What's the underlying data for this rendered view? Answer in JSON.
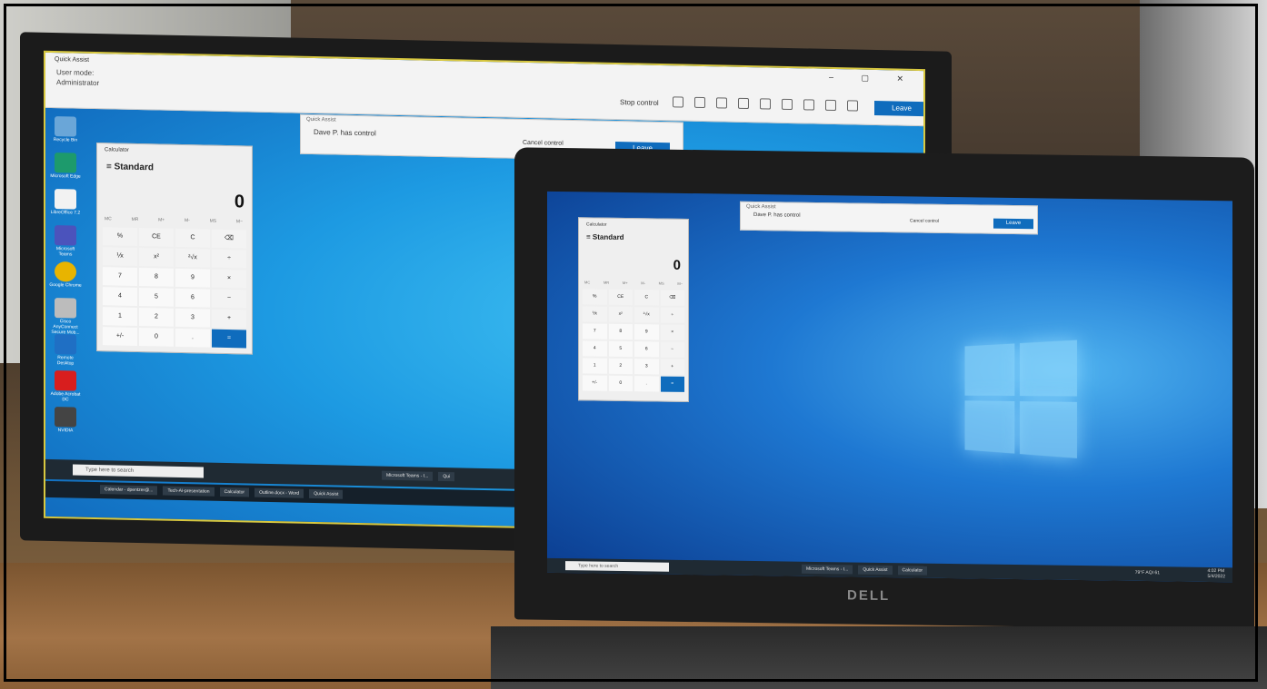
{
  "monitor": {
    "quick_assist_title": "Quick Assist",
    "user_mode_label": "User mode:",
    "user_mode_value": "Administrator",
    "stop_control": "Stop control",
    "leave": "Leave",
    "banner": {
      "title": "Quick Assist",
      "message": "Dave P. has control",
      "cancel": "Cancel control",
      "leave": "Leave"
    },
    "calculator": {
      "title": "Calculator",
      "mode": "Standard",
      "display": "0",
      "memory": [
        "MC",
        "MR",
        "M+",
        "M-",
        "MS",
        "M~"
      ],
      "keys": [
        "%",
        "CE",
        "C",
        "⌫",
        "⅟x",
        "x²",
        "²√x",
        "÷",
        "7",
        "8",
        "9",
        "×",
        "4",
        "5",
        "6",
        "−",
        "1",
        "2",
        "3",
        "+",
        "+/-",
        "0",
        ".",
        "="
      ]
    },
    "search_placeholder": "Type here to search",
    "taskbar_items": [
      "Microsoft Teams - I...",
      "Qui"
    ],
    "taskbar2_items": [
      "Calendar - dpentzer@...",
      "Tech-AI-presentation",
      "Calculator",
      "Outline.docx - Word",
      "Quick Assist"
    ],
    "desktop_icons": [
      {
        "label": "Recycle Bin",
        "color": "#6aa6d8"
      },
      {
        "label": "Microsoft Edge",
        "color": "#1d9a6c"
      },
      {
        "label": "LibreOffice 7.2",
        "color": "#f2f2f2"
      },
      {
        "label": "Microsoft Teams",
        "color": "#4b53bc"
      },
      {
        "label": "Google Chrome",
        "color": "#e8b400"
      },
      {
        "label": "Cisco AnyConnect Secure Mob...",
        "color": "#bcbcbc"
      },
      {
        "label": "Remote Desktop",
        "color": "#1f6fc4"
      },
      {
        "label": "Adobe Acrobat DC",
        "color": "#d81e1e"
      },
      {
        "label": "NVIDIA",
        "color": "#444444"
      }
    ]
  },
  "laptop": {
    "banner": {
      "title": "Quick Assist",
      "message": "Dave P. has control",
      "cancel": "Cancel control",
      "leave": "Leave"
    },
    "calculator": {
      "title": "Calculator",
      "mode": "Standard",
      "display": "0"
    },
    "search_placeholder": "Type here to search",
    "taskbar_items": [
      "Microsoft Teams - I...",
      "Quick Assist",
      "Calculator"
    ],
    "weather": "79°F AQI 61",
    "time": "4:02 PM",
    "date": "5/4/2022",
    "brand": "DELL"
  },
  "colors": {
    "accent": "#0f6cbd",
    "desktop_blue": "#1d9ae2"
  }
}
